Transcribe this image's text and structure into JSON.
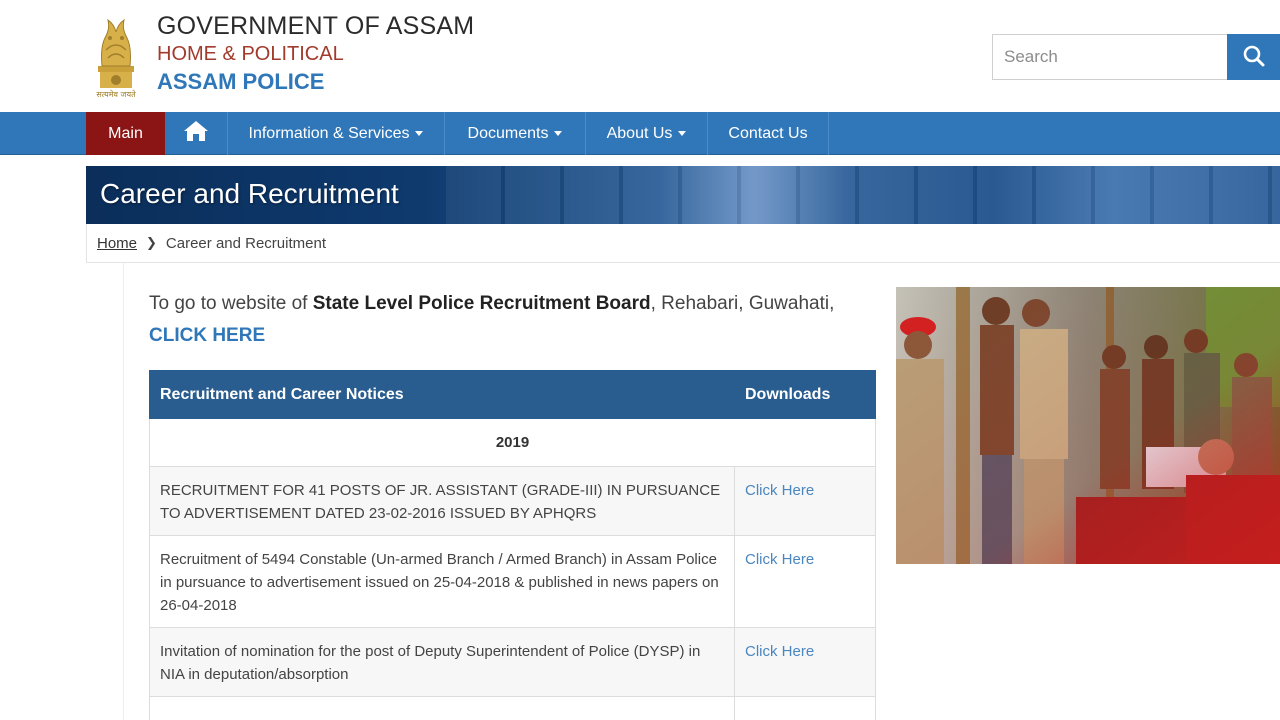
{
  "header": {
    "line1": "GOVERNMENT OF ASSAM",
    "line2": "HOME & POLITICAL",
    "line3": "ASSAM POLICE",
    "emblem_motto": "सत्यमेव जयते"
  },
  "search": {
    "placeholder": "Search",
    "icon": "search-icon"
  },
  "nav": {
    "items": [
      {
        "label": "Main",
        "active": true
      },
      {
        "label": "",
        "icon": "home-icon"
      },
      {
        "label": "Information & Services",
        "dropdown": true
      },
      {
        "label": "Documents",
        "dropdown": true
      },
      {
        "label": "About Us",
        "dropdown": true
      },
      {
        "label": "Contact Us"
      }
    ]
  },
  "banner": {
    "title": "Career and Recruitment"
  },
  "breadcrumb": {
    "home": "Home",
    "current": "Career and Recruitment"
  },
  "intro": {
    "prefix": "To go to website of ",
    "board": "State Level Police Recruitment Board",
    "location": ", Rehabari, Guwahati, ",
    "link": "CLICK HERE"
  },
  "table": {
    "headers": [
      "Recruitment and Career Notices",
      "Downloads"
    ],
    "year": "2019",
    "rows": [
      {
        "notice": "RECRUITMENT FOR 41 POSTS OF JR. ASSISTANT (GRADE-III) IN PURSUANCE TO ADVERTISEMENT DATED 23-02-2016 ISSUED BY APHQRS",
        "download": "Click Here"
      },
      {
        "notice": "Recruitment of 5494 Constable (Un-armed Branch / Armed Branch) in Assam Police in pursuance to advertisement issued on 25-04-2018 & published in news papers on 26-04-2018",
        "download": "Click Here"
      },
      {
        "notice": "Invitation of nomination for the post of Deputy Superintendent of  Police (DYSP) in NIA in deputation/absorption",
        "download": "Click Here"
      }
    ]
  },
  "colors": {
    "brand_blue": "#2f77b8",
    "main_red": "#8b1515",
    "table_header": "#2a5d8f",
    "title_red": "#a23b2c"
  }
}
